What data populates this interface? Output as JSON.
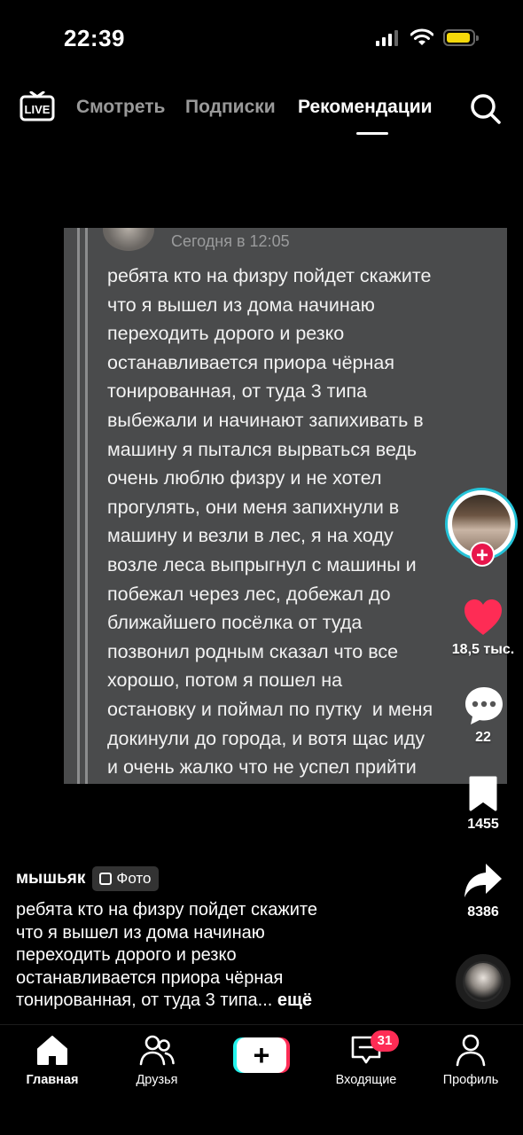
{
  "status_bar": {
    "time": "22:39",
    "battery_color": "#f5d90a"
  },
  "top_nav": {
    "live_label": "LIVE",
    "tabs": [
      {
        "label": "Смотреть",
        "active": false
      },
      {
        "label": "Подписки",
        "active": false
      },
      {
        "label": "Рекомендации",
        "active": true
      }
    ],
    "icons": [
      "live-tv-icon",
      "search-icon"
    ]
  },
  "post_image": {
    "timestamp": "Сегодня в 12:05",
    "message_lines": [
      "ребята кто на физру пойдет скажите",
      "что я вышел из дома начинаю",
      "переходить дорого и резко",
      "останавливается приора чёрная",
      "тонированная, от туда 3 типа",
      "выбежали и начинают запихивать в",
      "машину я пытался вырваться ведь",
      "очень люблю физру и не хотел",
      "прогулять, они меня запихнули в",
      "машину и везли в лес, я на ходу",
      "возле леса выпрыгнул с машины и",
      "побежал через лес, добежал до",
      "ближайшего посёлка от туда",
      "позвонил родным сказал что все",
      "хорошо, потом я пошел на",
      "остановку и поймал по путку  и меня",
      "докинули до города, и вотя щас иду",
      "и очень жалко что не успел прийти"
    ]
  },
  "actions": {
    "follow_symbol": "+",
    "likes": "18,5 тыс.",
    "comments": "22",
    "saves": "1455",
    "shares": "8386",
    "icons": [
      "heart-icon",
      "comment-icon",
      "bookmark-icon",
      "share-icon"
    ],
    "like_color": "#fe2c55"
  },
  "caption": {
    "author": "мышьяк",
    "badge": "Фото",
    "text_lines": [
      "ребята кто на физру пойдет скажите",
      "что я вышел из дома начинаю",
      "переходить дорого и резко",
      "останавливается приора чёрная",
      "тонированная, от туда 3 типа..."
    ],
    "more": "ещё"
  },
  "bottom_nav": {
    "items": [
      {
        "label": "Главная",
        "icon": "home-icon"
      },
      {
        "label": "Друзья",
        "icon": "friends-icon"
      },
      {
        "label": "",
        "icon": "create-plus-icon"
      },
      {
        "label": "Входящие",
        "icon": "inbox-icon"
      },
      {
        "label": "Профиль",
        "icon": "profile-icon"
      }
    ],
    "create_symbol": "+",
    "inbox_badge": "31",
    "accent_cyan": "#25f4ee",
    "accent_red": "#fe2c55"
  }
}
